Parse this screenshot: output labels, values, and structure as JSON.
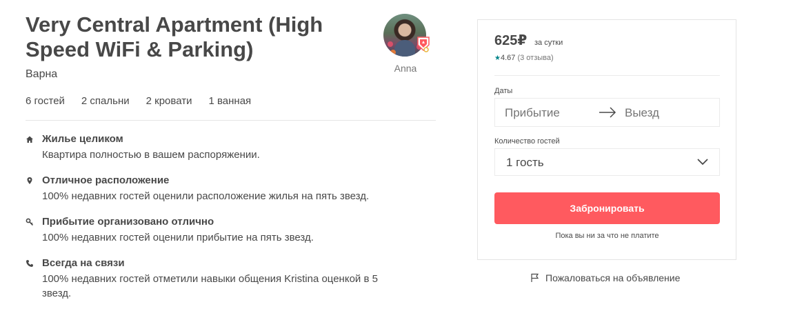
{
  "listing": {
    "title": "Very Central Apartment (High Speed WiFi & Parking)",
    "city": "Варна",
    "specs": [
      "6 гостей",
      "2 спальни",
      "2 кровати",
      "1 ванная"
    ]
  },
  "host": {
    "name": "Anna",
    "superhost_badge_icon": "superhost-badge-icon"
  },
  "features": [
    {
      "icon": "home-icon",
      "title": "Жилье целиком",
      "desc": "Квартира полностью в вашем распоряжении."
    },
    {
      "icon": "map-pin-icon",
      "title": "Отличное расположение",
      "desc": "100% недавних гостей оценили расположение жилья на пять звезд."
    },
    {
      "icon": "key-icon",
      "title": "Прибытие организовано отлично",
      "desc": "100% недавних гостей оценили прибытие на пять звезд."
    },
    {
      "icon": "phone-icon",
      "title": "Всегда на связи",
      "desc": "100% недавних гостей отметили навыки общения Kristina оценкой в 5 звезд."
    }
  ],
  "booking": {
    "price": "625₽",
    "per_night": "за сутки",
    "rating_star": "★",
    "rating": "4.67",
    "reviews": "(3 отзыва)",
    "dates_label": "Даты",
    "checkin_placeholder": "Прибытие",
    "checkout_placeholder": "Выезд",
    "guests_label": "Количество гостей",
    "guests_value": "1 гость",
    "book_button": "Забронировать",
    "note": "Пока вы ни за что не платите"
  },
  "report": {
    "label": "Пожаловаться на объявление"
  },
  "colors": {
    "accent": "#ff5a5f",
    "rating_star": "#008489",
    "text": "#484848",
    "muted": "#767676"
  }
}
